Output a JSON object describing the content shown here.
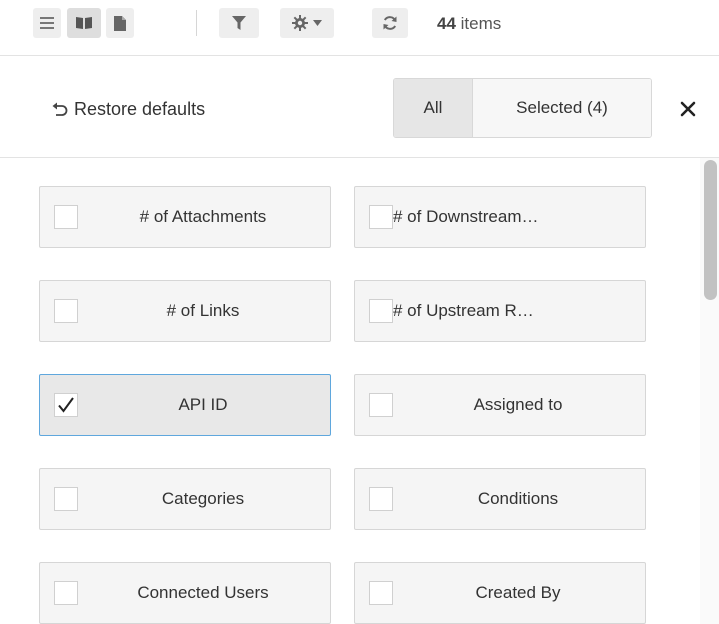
{
  "toolbar": {
    "icons": [
      "list-view-icon",
      "book-view-icon",
      "document-view-icon",
      "filter-icon",
      "gear-icon",
      "caret-down-icon",
      "refresh-icon"
    ],
    "count_number": "44",
    "count_unit": "items"
  },
  "columns_panel": {
    "restore_label": "Restore defaults",
    "tabs": [
      {
        "label": "All",
        "active": true
      },
      {
        "label": "Selected (4)",
        "active": false
      }
    ],
    "close_label": "×",
    "fields": [
      {
        "label": "# of Attachments",
        "checked": false
      },
      {
        "label": "# of Downstream…",
        "checked": false
      },
      {
        "label": "# of Links",
        "checked": false
      },
      {
        "label": "# of Upstream R…",
        "checked": false
      },
      {
        "label": "API ID",
        "checked": true
      },
      {
        "label": "Assigned to",
        "checked": false
      },
      {
        "label": "Categories",
        "checked": false
      },
      {
        "label": "Conditions",
        "checked": false
      },
      {
        "label": "Connected Users",
        "checked": false
      },
      {
        "label": "Created By",
        "checked": false
      }
    ]
  },
  "colors": {
    "checked_border": "#5fa7dd",
    "tile_bg": "#f5f5f5"
  }
}
